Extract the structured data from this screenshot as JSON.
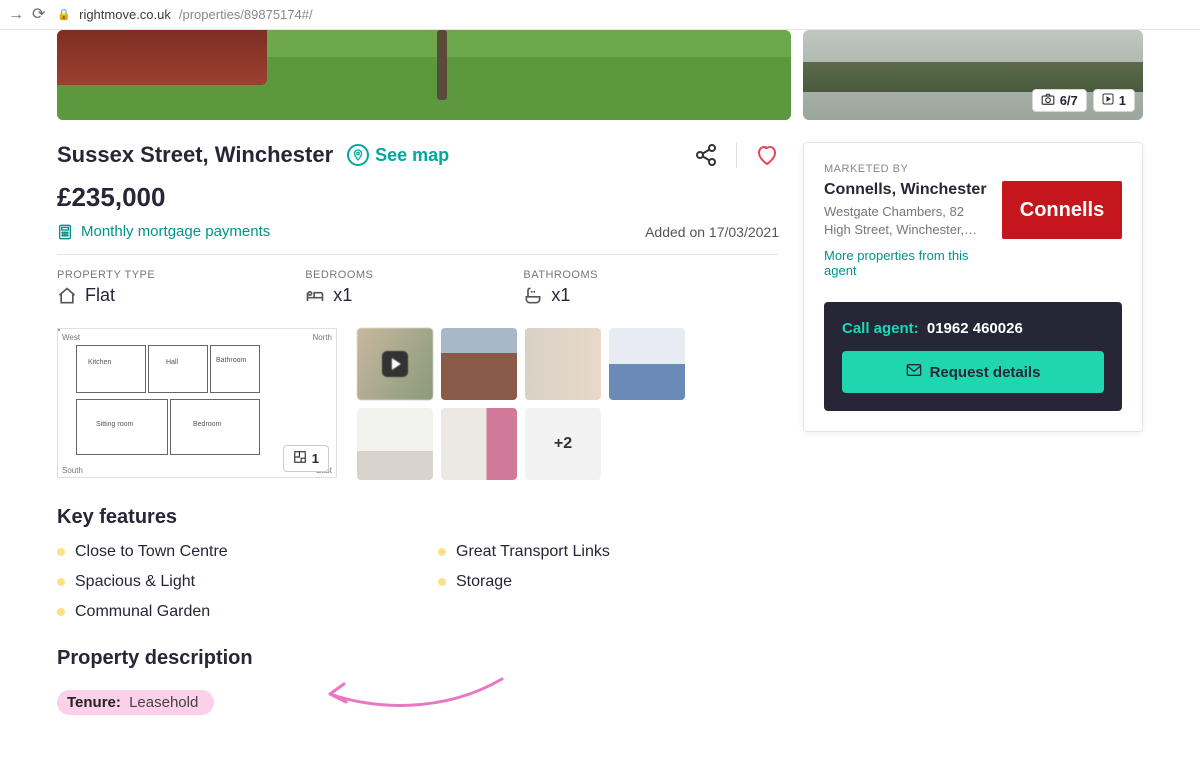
{
  "browser": {
    "url_domain": "rightmove.co.uk",
    "url_path": "/properties/89875174#/"
  },
  "media": {
    "photo_count": "6/7",
    "video_count": "1",
    "floorplan_count": "1",
    "more_thumbs": "+2",
    "fp": {
      "west": "West",
      "north": "North",
      "south": "South",
      "east": "East",
      "kitchen": "Kitchen",
      "hall": "Hall",
      "bathroom": "Bathroom",
      "sitting": "Sitting room",
      "bedroom": "Bedroom"
    }
  },
  "listing": {
    "address": "Sussex Street, Winchester",
    "see_map": "See map",
    "price": "£235,000",
    "mortgage_link": "Monthly mortgage payments",
    "added": "Added on 17/03/2021",
    "facts": {
      "type_label": "PROPERTY TYPE",
      "type_value": "Flat",
      "bed_label": "BEDROOMS",
      "bed_value": "x1",
      "bath_label": "BATHROOMS",
      "bath_value": "x1"
    },
    "features_heading": "Key features",
    "features": [
      "Close to Town Centre",
      "Great Transport Links",
      "Spacious & Light",
      "Storage",
      "Communal Garden"
    ],
    "desc_heading": "Property description",
    "tenure_label": "Tenure:",
    "tenure_value": "Leasehold"
  },
  "agent": {
    "marketed_by": "MARKETED BY",
    "name": "Connells, Winchester",
    "address": "Westgate Chambers, 82 High Street, Winchester,…",
    "more": "More properties from this agent",
    "logo": "Connells",
    "call_label": "Call agent:",
    "phone": "01962 460026",
    "request": "Request details"
  }
}
